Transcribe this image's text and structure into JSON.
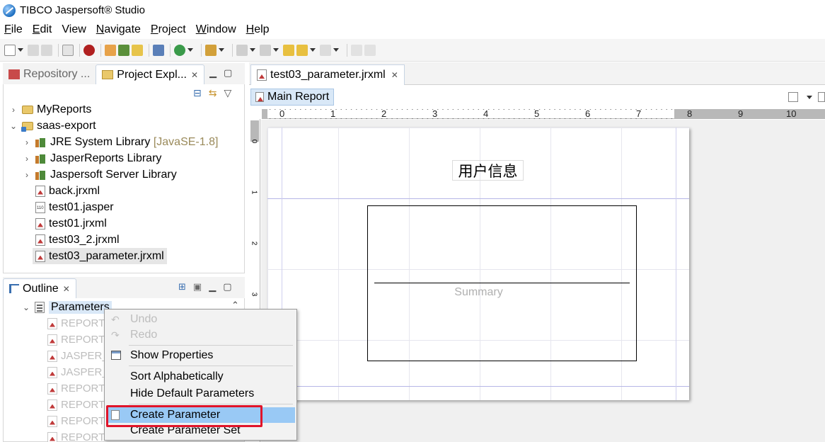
{
  "window": {
    "title": "TIBCO Jaspersoft® Studio"
  },
  "menubar": {
    "items": [
      {
        "label": "File",
        "u": "F",
        "rest": "ile"
      },
      {
        "label": "Edit",
        "u": "E",
        "rest": "dit"
      },
      {
        "label": "View",
        "u": "",
        "rest": "View"
      },
      {
        "label": "Navigate",
        "u": "N",
        "rest": "avigate"
      },
      {
        "label": "Project",
        "u": "P",
        "rest": "roject"
      },
      {
        "label": "Window",
        "u": "W",
        "rest": "indow"
      },
      {
        "label": "Help",
        "u": "H",
        "rest": "elp"
      }
    ]
  },
  "left_panel": {
    "tabs": [
      "Repository ...",
      "Project Expl..."
    ],
    "tree": [
      {
        "label": "MyReports",
        "type": "folder",
        "chev": "›",
        "indent": 0
      },
      {
        "label": "saas-export",
        "type": "project",
        "chev": "⌄",
        "indent": 0
      },
      {
        "label": "JRE System Library",
        "suffix": "[JavaSE-1.8]",
        "type": "lib",
        "chev": "›",
        "indent": 1
      },
      {
        "label": "JasperReports Library",
        "type": "lib",
        "chev": "›",
        "indent": 1
      },
      {
        "label": "Jaspersoft Server Library",
        "type": "lib",
        "chev": "›",
        "indent": 1
      },
      {
        "label": "back.jrxml",
        "type": "file",
        "indent": 2
      },
      {
        "label": "test01.jasper",
        "type": "jasper",
        "indent": 2
      },
      {
        "label": "test01.jrxml",
        "type": "file",
        "indent": 2
      },
      {
        "label": "test03_2.jrxml",
        "type": "file",
        "indent": 2
      },
      {
        "label": "test03_parameter.jrxml",
        "type": "file",
        "indent": 2,
        "selected": true
      }
    ]
  },
  "outline_panel": {
    "tab": "Outline",
    "root": "Parameters",
    "children": [
      "REPORT",
      "REPORT",
      "JASPER_",
      "JASPER_",
      "REPORT",
      "REPORT",
      "REPORT",
      "REPORT"
    ]
  },
  "editor": {
    "tab": "test03_parameter.jrxml",
    "subtab": "Main Report",
    "ruler_labels": [
      "0",
      "1",
      "2",
      "3",
      "4",
      "5",
      "6",
      "7",
      "8",
      "9",
      "10"
    ],
    "report_title": "用户信息",
    "summary_label": "Summary"
  },
  "context_menu": {
    "items": [
      {
        "label": "Undo",
        "disabled": true
      },
      {
        "label": "Redo",
        "disabled": true
      },
      {
        "label": "Show Properties"
      },
      {
        "label": "Sort Alphabetically"
      },
      {
        "label": "Hide Default Parameters"
      },
      {
        "label": "Create Parameter",
        "highlighted": true
      },
      {
        "label": "Create Parameter Set"
      }
    ]
  },
  "colors": {
    "highlight_border": "#e0142a",
    "menu_highlight": "#99c9f5"
  }
}
